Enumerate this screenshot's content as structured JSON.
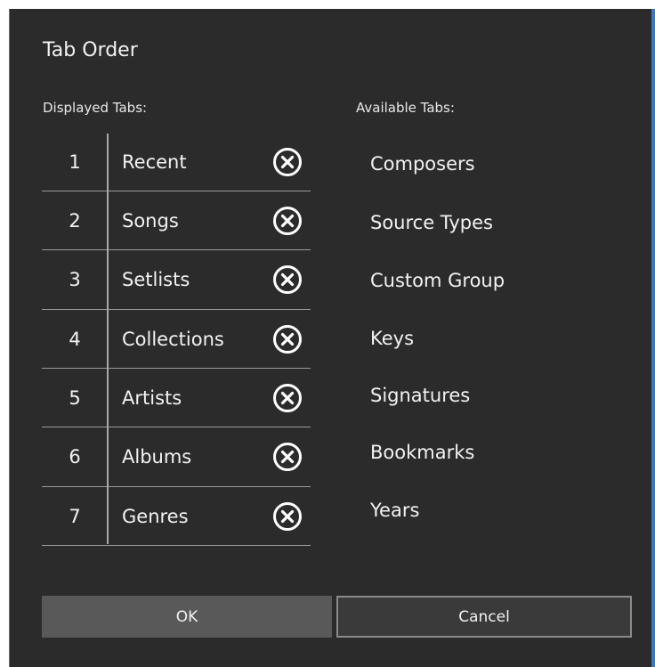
{
  "dialog": {
    "title": "Tab Order",
    "displayed_label": "Displayed Tabs:",
    "available_label": "Available Tabs:"
  },
  "displayed_tabs": [
    {
      "number": "1",
      "name": "Recent"
    },
    {
      "number": "2",
      "name": "Songs"
    },
    {
      "number": "3",
      "name": "Setlists"
    },
    {
      "number": "4",
      "name": "Collections"
    },
    {
      "number": "5",
      "name": "Artists"
    },
    {
      "number": "6",
      "name": "Albums"
    },
    {
      "number": "7",
      "name": "Genres"
    }
  ],
  "available_tabs": [
    "Composers",
    "Source Types",
    "Custom Group",
    "Keys",
    "Signatures",
    "Bookmarks",
    "Years"
  ],
  "buttons": {
    "ok_label": "OK",
    "cancel_label": "Cancel"
  },
  "icons": {
    "remove": "close-circle-icon"
  }
}
